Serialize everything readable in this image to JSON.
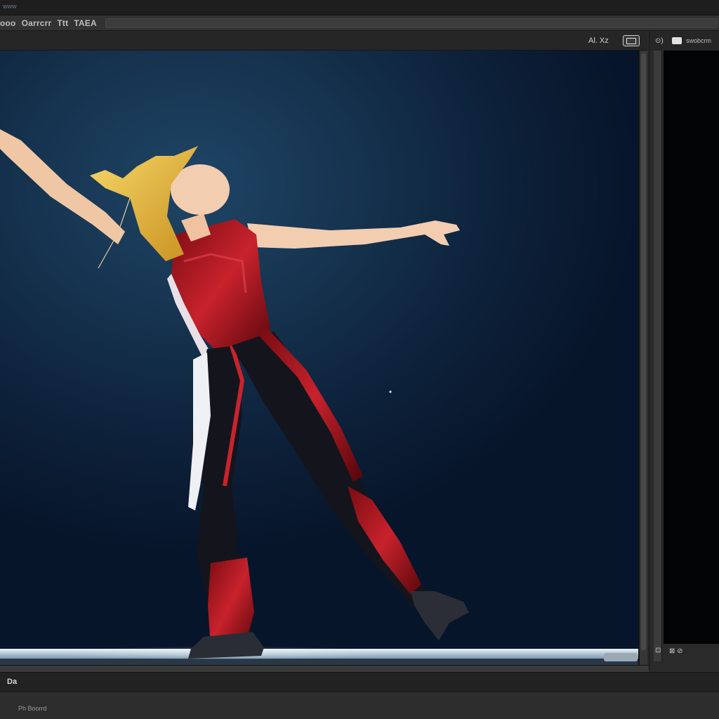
{
  "app": {
    "title": "www"
  },
  "toolbar": {
    "items": [
      {
        "label": "ooo"
      },
      {
        "label": "Oarrcrr"
      },
      {
        "label": "Ttt"
      },
      {
        "label": "TAEA"
      }
    ]
  },
  "viewport": {
    "zoom_label": "Al. Xz",
    "scene": "dancer-figure",
    "colors": {
      "bg_center": "#1f4566",
      "bg_edge": "#07152a",
      "suit_red": "#b01a22",
      "suit_dark": "#12131a",
      "hair": "#e7b93c",
      "skin": "#f3c9a8",
      "floor": "#d8e6ef"
    }
  },
  "side_panel": {
    "header_icon": "⊙)",
    "header_label": "swobcrm",
    "footer_icon": "⊡",
    "footer_value": "⊠ ⊘"
  },
  "bottom_bar": {
    "tab_label": "Da"
  },
  "status_bar": {
    "text": "Ph Boorrd"
  }
}
